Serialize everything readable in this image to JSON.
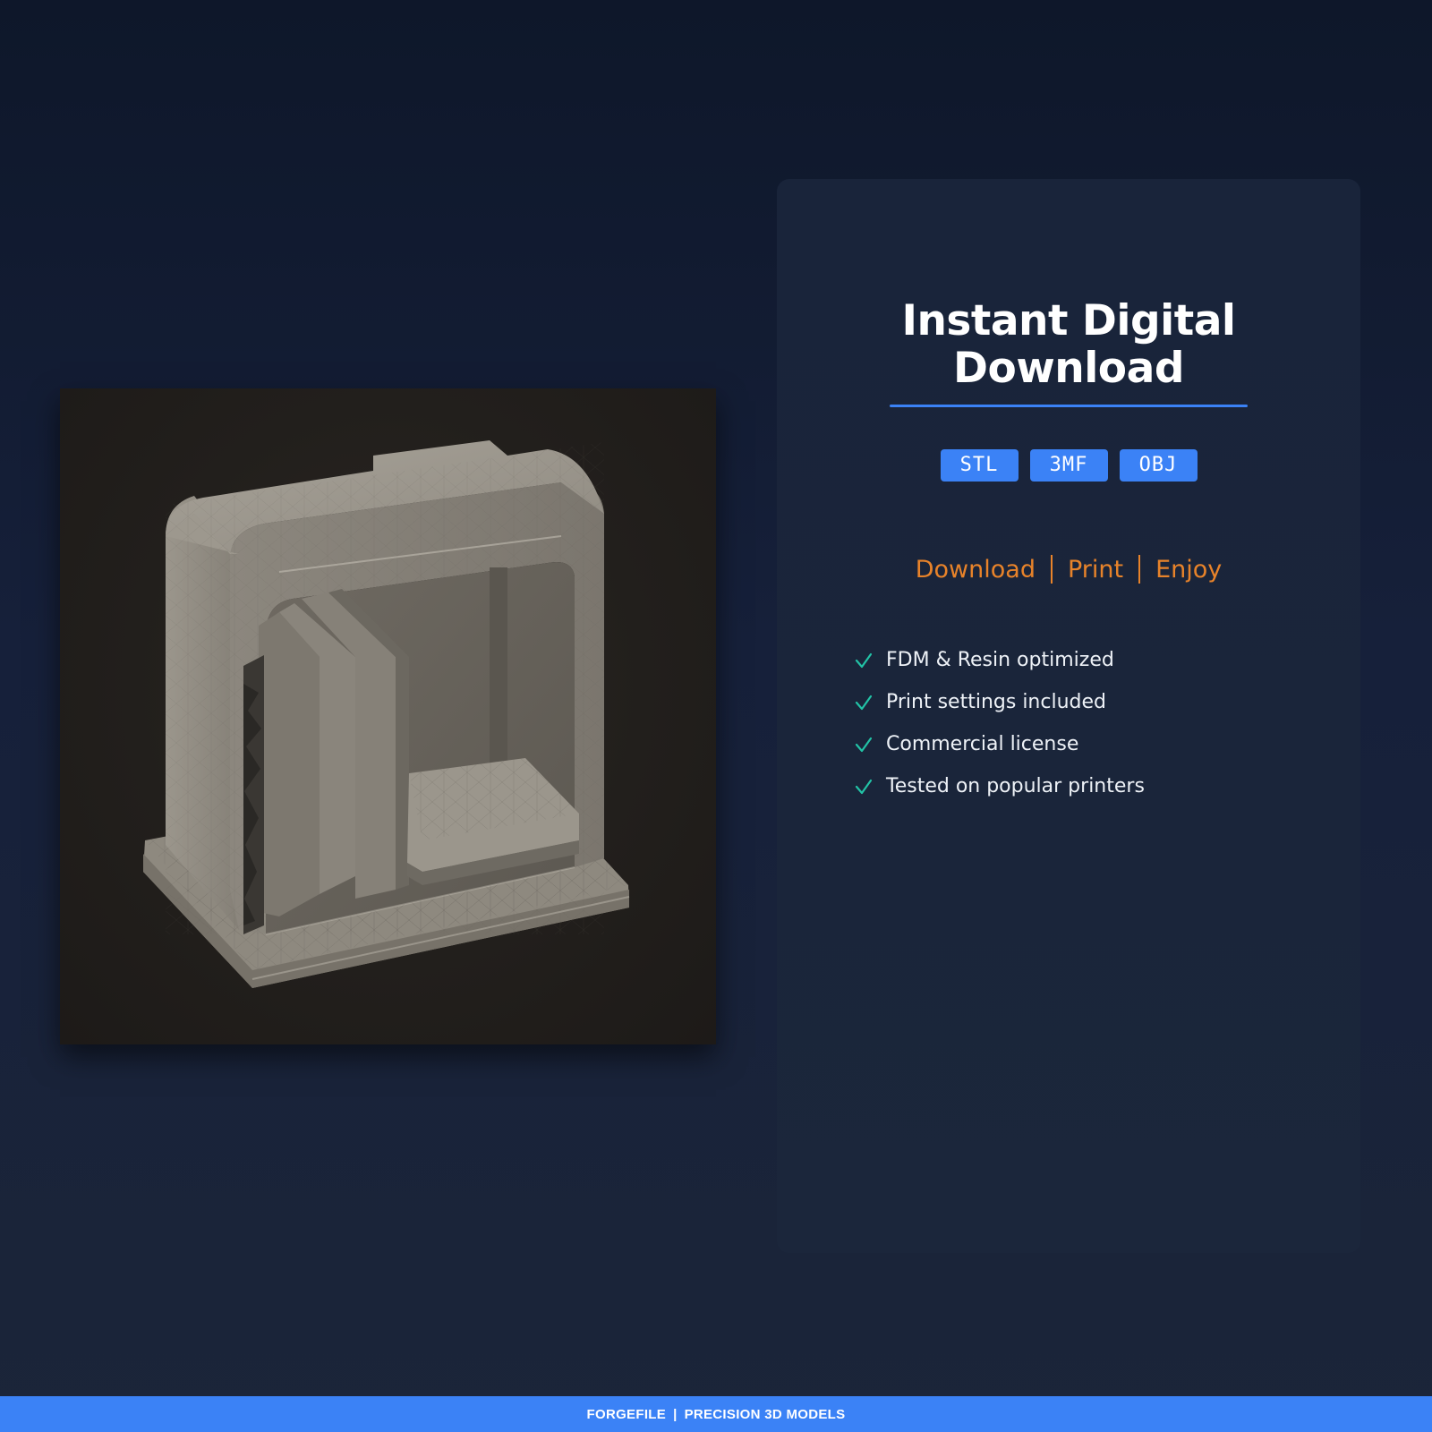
{
  "card": {
    "title_line1": "Instant Digital",
    "title_line2": "Download",
    "formats": [
      "STL",
      "3MF",
      "OBJ"
    ],
    "steps": [
      "Download",
      "Print",
      "Enjoy"
    ],
    "features": [
      "FDM & Resin optimized",
      "Print settings included",
      "Commercial license",
      "Tested on popular printers"
    ]
  },
  "footer": {
    "brand": "FORGEFILE",
    "separator": "|",
    "tagline": "PRECISION 3D MODELS"
  },
  "colors": {
    "accent_blue": "#3b82f6",
    "accent_orange": "#e8832a",
    "check_green": "#22c3a6",
    "background": "#0e172a"
  },
  "icons": {
    "product_image": "bookshelf-3d-model",
    "feature_bullet": "check-icon"
  }
}
